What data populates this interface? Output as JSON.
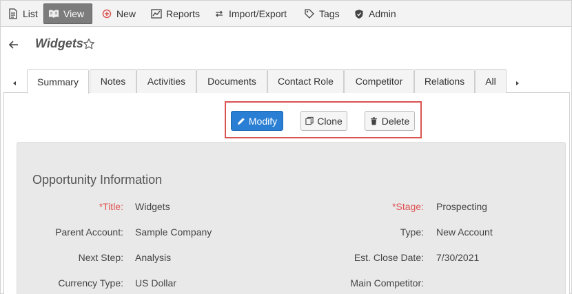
{
  "toolbar": {
    "items": [
      {
        "label": "List",
        "icon": "document-icon"
      },
      {
        "label": "View",
        "icon": "book-icon",
        "active": true
      },
      {
        "label": "New",
        "icon": "plus-circle-icon"
      },
      {
        "label": "Reports",
        "icon": "chart-icon"
      },
      {
        "label": "Import/Export",
        "icon": "swap-arrows-icon"
      },
      {
        "label": "Tags",
        "icon": "tag-icon"
      },
      {
        "label": "Admin",
        "icon": "shield-icon"
      }
    ]
  },
  "header": {
    "title": "Widgets"
  },
  "tabs": [
    {
      "label": "Summary",
      "active": true
    },
    {
      "label": "Notes"
    },
    {
      "label": "Activities"
    },
    {
      "label": "Documents"
    },
    {
      "label": "Contact Role"
    },
    {
      "label": "Competitor"
    },
    {
      "label": "Relations"
    },
    {
      "label": "All"
    }
  ],
  "actions": {
    "modify": "Modify",
    "clone": "Clone",
    "delete": "Delete"
  },
  "section": {
    "title": "Opportunity Information",
    "fields": {
      "title": {
        "label": "*Title:",
        "value": "Widgets"
      },
      "stage": {
        "label": "*Stage:",
        "value": "Prospecting"
      },
      "parent": {
        "label": "Parent Account:",
        "value": "Sample Company"
      },
      "type": {
        "label": "Type:",
        "value": "New Account"
      },
      "next_step": {
        "label": "Next Step:",
        "value": "Analysis"
      },
      "close_date": {
        "label": "Est. Close Date:",
        "value": "7/30/2021"
      },
      "currency": {
        "label": "Currency Type:",
        "value": "US Dollar"
      },
      "competitor": {
        "label": "Main Competitor:",
        "value": ""
      }
    }
  },
  "colors": {
    "primary_button": "#2a7fd4",
    "required_label": "#e05252",
    "highlight_frame": "#d9534f",
    "active_toolbar": "#7c7c7c"
  }
}
